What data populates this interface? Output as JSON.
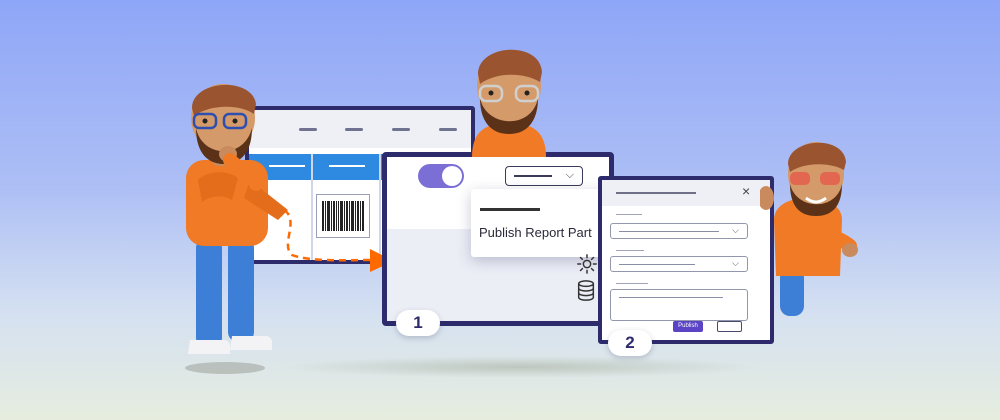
{
  "dropdown": {
    "menu_item": "Publish Report Part"
  },
  "dialog": {
    "publish_label": "Publish",
    "close_icon": "×"
  },
  "steps": {
    "one": "1",
    "two": "2"
  },
  "icons": {
    "settings": "gear-icon",
    "database": "database-icon",
    "dropdown_chevron": "chevron-down-icon"
  },
  "colors": {
    "accent": "#5a43c4",
    "frame": "#2d2b6b",
    "toggle": "#7b6fd6",
    "arrow": "#ff6a00",
    "header_blue": "#2d8ae0"
  }
}
